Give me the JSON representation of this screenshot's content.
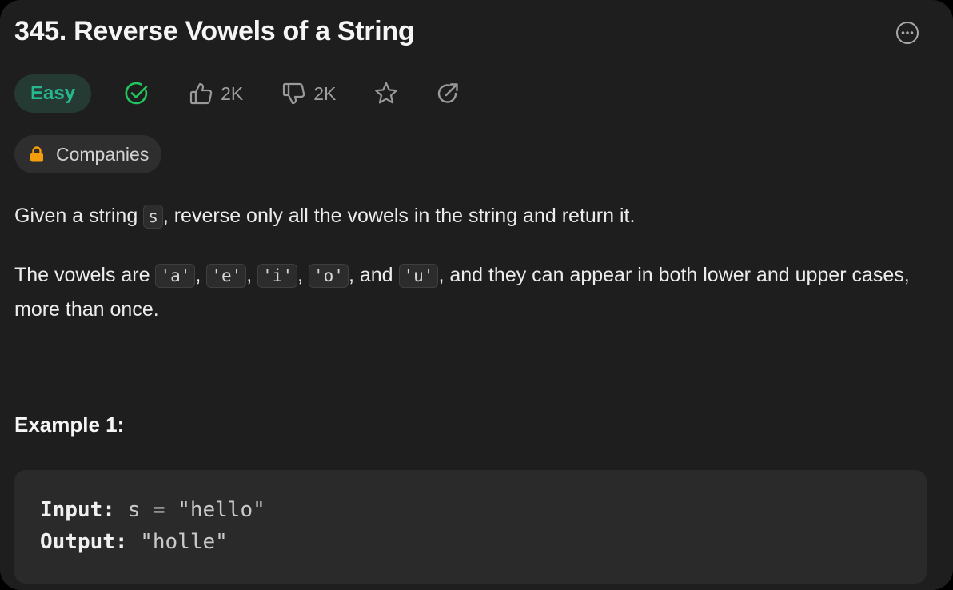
{
  "problem": {
    "title": "345. Reverse Vowels of a String",
    "difficulty": "Easy",
    "likes": "2K",
    "dislikes": "2K",
    "companies_label": "Companies"
  },
  "description": {
    "p1": {
      "before": "Given a string ",
      "code": "s",
      "after": ", reverse only all the vowels in the string and return it."
    },
    "p2": {
      "lead": "The vowels are ",
      "v1": "'a'",
      "sep1": ", ",
      "v2": "'e'",
      "sep2": ", ",
      "v3": "'i'",
      "sep3": ", ",
      "v4": "'o'",
      "sep4": ", and ",
      "v5": "'u'",
      "tail": ", and they can appear in both lower and upper cases, more than once."
    }
  },
  "example1": {
    "title": "Example 1:",
    "input_label": "Input:",
    "input_value": " s = \"hello\"",
    "output_label": "Output:",
    "output_value": " \"holle\""
  },
  "colors": {
    "easy": "#25b88e",
    "solved_check": "#22c55e",
    "lock": "#f59e0b"
  },
  "icons": [
    "more-horizontal-icon",
    "check-circle-icon",
    "thumbs-up-icon",
    "thumbs-down-icon",
    "star-icon",
    "share-icon",
    "lock-icon"
  ]
}
